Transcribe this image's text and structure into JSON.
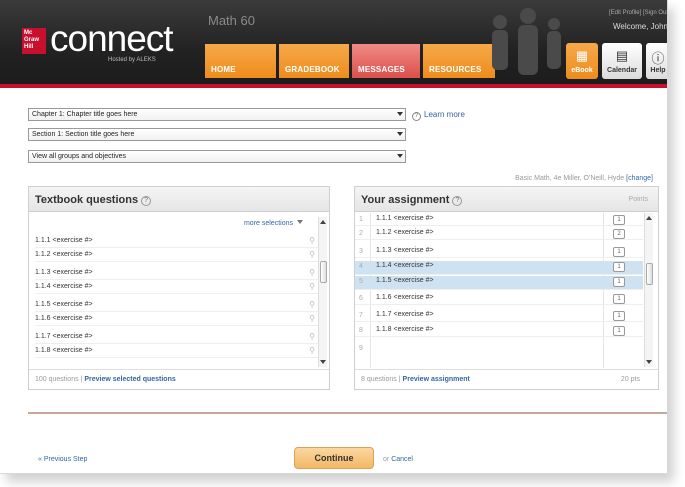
{
  "header": {
    "logo_badge": "Mc Graw Hill",
    "logo_text": "connect",
    "logo_sub": "Hosted by ALEKS",
    "course_title": "Math 60",
    "tabs": [
      {
        "label": "HOME"
      },
      {
        "label": "GRADEBOOK"
      },
      {
        "label": "MESSAGES"
      },
      {
        "label": "RESOURCES"
      }
    ],
    "top_links": "[Edit Profile] [Sign Out",
    "welcome": "Welcome, John",
    "buttons": {
      "ebook": "eBook",
      "calendar": "Calendar",
      "help": "Help"
    }
  },
  "filters": {
    "chapter": "Chapter 1: Chapter title goes here",
    "section": "Section 1: Section title goes here",
    "groups": "View all groups and objectives",
    "learn_more": "Learn more"
  },
  "book_meta": {
    "text": "Basic Math, 4e Miller, O'Neill, Hyde",
    "change": "[change]"
  },
  "textbook": {
    "title": "Textbook questions",
    "more_selections": "more selections",
    "items": [
      "1.1.1 <exercise #>",
      "1.1.2 <exercise #>",
      "1.1.3 <exercise #>",
      "1.1.4 <exercise #>",
      "1.1.5 <exercise #>",
      "1.1.6 <exercise #>",
      "1.1.7 <exercise #>",
      "1.1.8 <exercise #>"
    ],
    "count": "100 questions",
    "sep": "|",
    "preview": "Preview selected questions"
  },
  "assignment": {
    "title": "Your assignment",
    "points_header": "Points",
    "rows": [
      {
        "num": "1",
        "label": "1.1.1 <exercise #>",
        "pts": "1"
      },
      {
        "num": "2",
        "label": "1.1.2 <exercise #>",
        "pts": "2"
      },
      {
        "num": "3",
        "label": "1.1.3 <exercise #>",
        "pts": "1"
      },
      {
        "num": "4",
        "label": "1.1.4 <exercise #>",
        "pts": "1"
      },
      {
        "num": "5",
        "label": "1.1.5 <exercise #>",
        "pts": "1"
      },
      {
        "num": "6",
        "label": "1.1.6 <exercise #>",
        "pts": "1"
      },
      {
        "num": "7",
        "label": "1.1.7 <exercise #>",
        "pts": "1"
      },
      {
        "num": "8",
        "label": "1.1.8 <exercise #>",
        "pts": "1"
      },
      {
        "num": "9",
        "label": "",
        "pts": ""
      }
    ],
    "count": "8 questions",
    "sep": "|",
    "preview": "Preview assignment",
    "total": "20 pts"
  },
  "footer": {
    "prev": "« Previous Step",
    "continue": "Continue",
    "or": "or",
    "cancel": "Cancel"
  }
}
